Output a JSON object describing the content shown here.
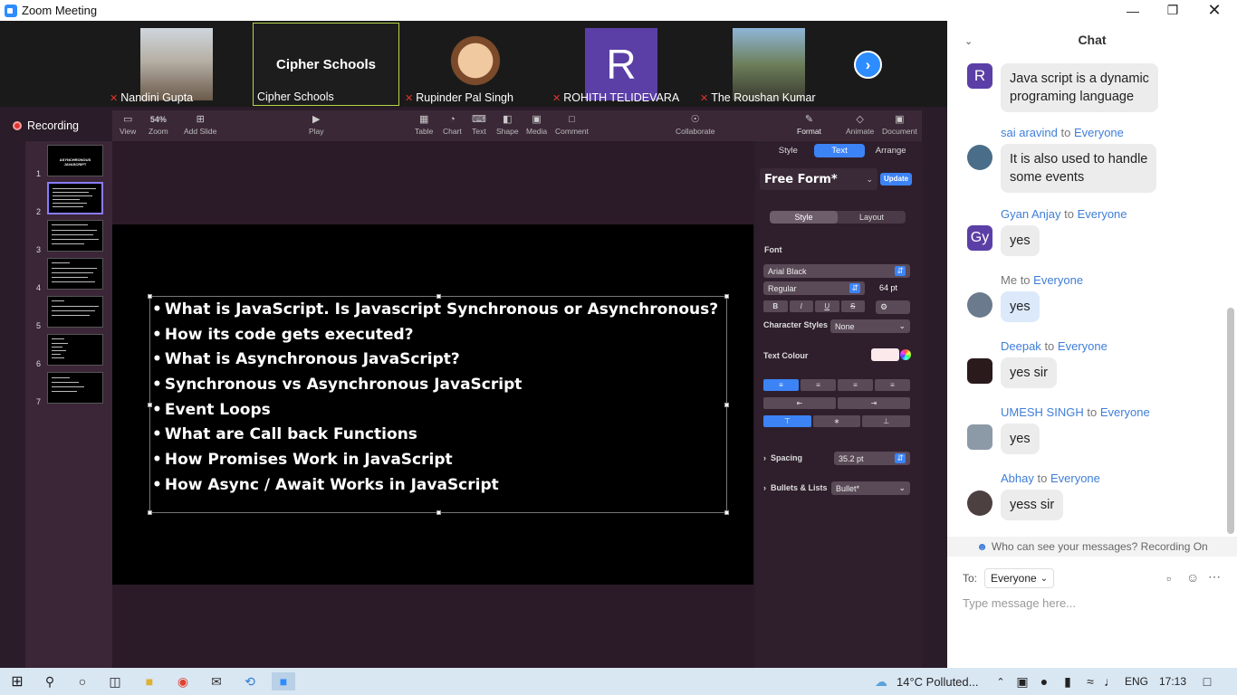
{
  "window": {
    "title": "Zoom Meeting"
  },
  "participants": [
    {
      "name": "Nandini Gupta",
      "muted": true
    },
    {
      "name": "Cipher Schools",
      "muted": false,
      "label": "Cipher Schools"
    },
    {
      "name": "Rupinder Pal Singh",
      "muted": true
    },
    {
      "name": "ROHITH TELIDEVARA",
      "muted": true,
      "initial": "R"
    },
    {
      "name": "The Roushan Kumar",
      "muted": true
    }
  ],
  "recording": {
    "label": "Recording"
  },
  "keynote": {
    "zoom": "54%",
    "toolbar": {
      "view": "View",
      "zoom": "Zoom",
      "add_slide": "Add Slide",
      "play": "Play",
      "table": "Table",
      "chart": "Chart",
      "text": "Text",
      "shape": "Shape",
      "media": "Media",
      "comment": "Comment",
      "collaborate": "Collaborate",
      "format": "Format",
      "animate": "Animate",
      "document": "Document"
    },
    "slide_numbers": [
      "1",
      "2",
      "3",
      "4",
      "5",
      "6",
      "7"
    ],
    "thumb1_title": "ASYNCHRONOUS JAVASCRIPT",
    "slide_bullets": [
      "What is JavaScript. Is Javascript Synchronous or Asynchronous?",
      "How its code gets executed?",
      "What is Asynchronous JavaScript?",
      "Synchronous vs Asynchronous JavaScript",
      "Event Loops",
      "What are Call back Functions",
      "How Promises Work in JavaScript",
      "How Async / Await Works in JavaScript"
    ],
    "inspector": {
      "tabs": [
        "Style",
        "Text",
        "Arrange"
      ],
      "paragraph_style": "Free Form*",
      "update": "Update",
      "subtabs": [
        "Style",
        "Layout"
      ],
      "font_label": "Font",
      "font_family": "Arial Black",
      "font_weight": "Regular",
      "font_size": "64 pt",
      "format_buttons": [
        "B",
        "I",
        "U",
        "S"
      ],
      "character_styles_label": "Character Styles",
      "character_styles_value": "None",
      "text_colour_label": "Text Colour",
      "spacing_label": "Spacing",
      "spacing_value": "35.2 pt",
      "bullets_label": "Bullets & Lists",
      "bullets_value": "Bullet*"
    }
  },
  "chat": {
    "header": "Chat",
    "messages": [
      {
        "initial": "R",
        "avatar_color": "#5b3fa6",
        "sender": "",
        "to": "",
        "text_lines": [
          "Java script is a dynamic",
          "programing language"
        ]
      },
      {
        "initial": "",
        "avatar_color": "#4a6e8a",
        "sender": "sai aravind",
        "to": "Everyone",
        "text_lines": [
          "It is also used to handle",
          "some events"
        ]
      },
      {
        "initial": "Gy",
        "avatar_color": "#5b3fa6",
        "sender": "Gyan Anjay",
        "to": "Everyone",
        "text_lines": [
          "yes"
        ]
      },
      {
        "initial": "",
        "avatar_color": "#6b7a8c",
        "sender": "Me",
        "to": "Everyone",
        "text_lines": [
          "yes"
        ]
      },
      {
        "initial": "",
        "avatar_color": "#2a1a1c",
        "sender": "Deepak",
        "to": "Everyone",
        "text_lines": [
          "yes sir"
        ]
      },
      {
        "initial": "",
        "avatar_color": "#8c9aa8",
        "sender": "UMESH SINGH",
        "to": "Everyone",
        "text_lines": [
          "yes"
        ]
      },
      {
        "initial": "",
        "avatar_color": "#4d4040",
        "sender": "Abhay",
        "to": "Everyone",
        "text_lines": [
          "yess sir"
        ]
      }
    ],
    "to_word": "to",
    "privacy_note": "Who can see your messages? Recording On",
    "to_label": "To:",
    "to_value": "Everyone",
    "input_placeholder": "Type message here..."
  },
  "taskbar": {
    "weather": "14°C  Polluted...",
    "language": "ENG",
    "time": "17:13"
  }
}
